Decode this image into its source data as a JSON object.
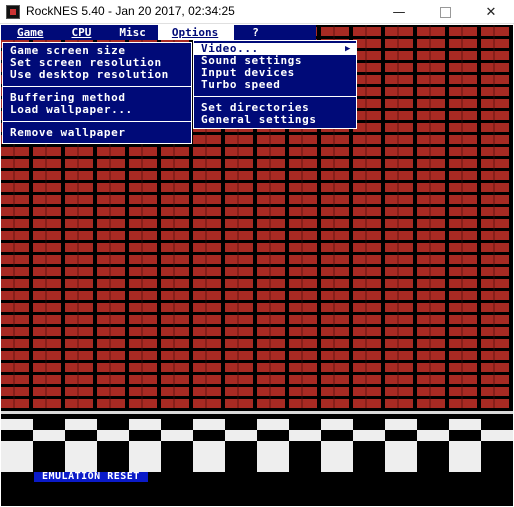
{
  "window": {
    "title": "RockNES 5.40 - Jan 20 2017, 02:34:25",
    "minimize_glyph": "—",
    "close_glyph": "✕"
  },
  "menubar": {
    "items": [
      {
        "label": "Game"
      },
      {
        "label": "CPU"
      },
      {
        "label": "Misc"
      },
      {
        "label": "Options"
      },
      {
        "label": "?"
      }
    ]
  },
  "misc_menu": {
    "items": [
      "Game screen size",
      "Set screen resolution",
      "Use desktop resolution",
      "Buffering method",
      "Load wallpaper...",
      "Remove wallpaper"
    ]
  },
  "options_menu": {
    "items": [
      "Video...",
      "Sound settings",
      "Input devices",
      "Turbo speed",
      "Set directories",
      "General settings"
    ],
    "submenu_arrow": "▶"
  },
  "status": {
    "text": "EMULATION RESET"
  },
  "colors": {
    "menu_bg": "#000a78",
    "brick": "#a82a23",
    "status_bg": "#0a1ac8"
  }
}
